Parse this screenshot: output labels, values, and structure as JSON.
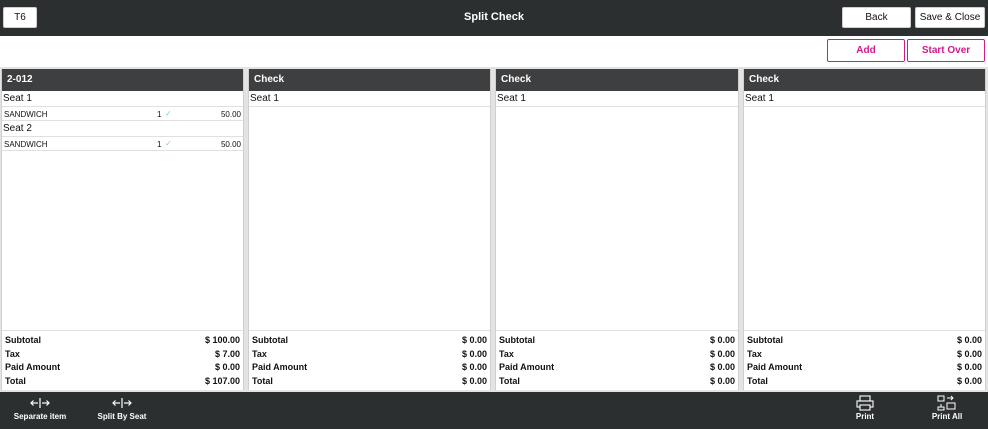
{
  "header": {
    "table_label": "T6",
    "title": "Split Check",
    "back_label": "Back",
    "save_close_label": "Save & Close"
  },
  "actions": {
    "add_label": "Add",
    "start_over_label": "Start Over"
  },
  "totals_labels": {
    "subtotal": "Subtotal",
    "tax": "Tax",
    "paid": "Paid Amount",
    "total": "Total"
  },
  "checks": [
    {
      "title": "2-012",
      "seats": [
        {
          "label": "Seat 1",
          "items": [
            {
              "name": "SANDWICH",
              "qty": "1",
              "price": "50.00"
            }
          ]
        },
        {
          "label": "Seat 2",
          "items": [
            {
              "name": "SANDWICH",
              "qty": "1",
              "price": "50.00"
            }
          ]
        }
      ],
      "subtotal": "$ 100.00",
      "tax": "$ 7.00",
      "paid": "$ 0.00",
      "total": "$ 107.00"
    },
    {
      "title": "Check",
      "seats": [
        {
          "label": "Seat 1",
          "items": []
        }
      ],
      "subtotal": "$ 0.00",
      "tax": "$ 0.00",
      "paid": "$ 0.00",
      "total": "$ 0.00"
    },
    {
      "title": "Check",
      "seats": [
        {
          "label": "Seat 1",
          "items": []
        }
      ],
      "subtotal": "$ 0.00",
      "tax": "$ 0.00",
      "paid": "$ 0.00",
      "total": "$ 0.00"
    },
    {
      "title": "Check",
      "seats": [
        {
          "label": "Seat 1",
          "items": []
        }
      ],
      "subtotal": "$ 0.00",
      "tax": "$ 0.00",
      "paid": "$ 0.00",
      "total": "$ 0.00"
    }
  ],
  "footer": {
    "separate_item": {
      "label": "Separate item",
      "icon": "split-arrows-icon"
    },
    "split_by_seat": {
      "label": "Split By Seat",
      "icon": "split-arrows-icon"
    },
    "print": {
      "label": "Print",
      "icon": "printer-icon"
    },
    "print_all": {
      "label": "Print All",
      "icon": "print-all-icon"
    }
  },
  "colors": {
    "bar": "#2c2f30",
    "panel_header": "#3d3f41",
    "accent": "#d01a8c",
    "check_mark": "#7fd4c4"
  }
}
